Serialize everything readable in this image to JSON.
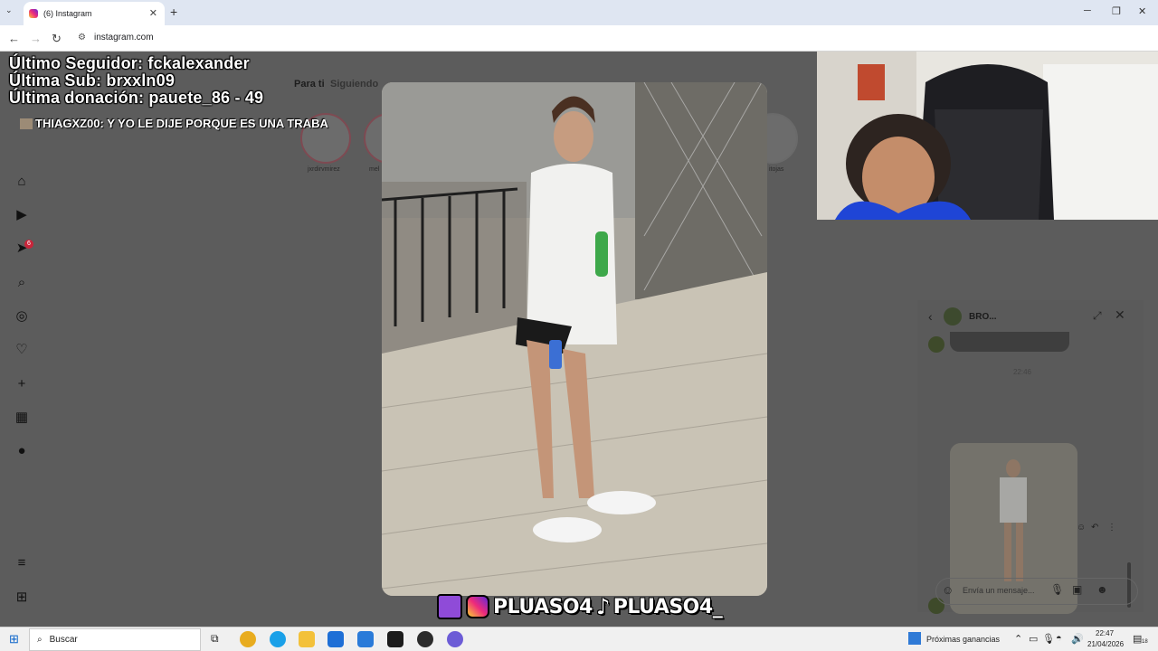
{
  "browser": {
    "tab_title": "(6) Instagram",
    "url": "instagram.com"
  },
  "stream_overlay": {
    "last_follower": "Último Seguidor: fckalexander",
    "last_sub": "Última Sub: brxxln09",
    "last_donation": "Última donación: pauete_86 - 49",
    "chat_message": "THIAGXZ00: Y YO LE DIJE PORQUE ES UNA TRABA",
    "handle_1": "PLUASO4",
    "handle_2": "PLUASO4_"
  },
  "instagram": {
    "sidebar_badge": "6",
    "feed_tabs": [
      "Para ti",
      "Siguiendo"
    ],
    "stories": [
      "jxrdirvmirez",
      "mel",
      "itojas"
    ],
    "dm": {
      "name": "BRO...",
      "timestamp": "22:46",
      "input_placeholder": "Envía un mensaje..."
    }
  },
  "taskbar": {
    "search_label": "Buscar",
    "news_label": "Próximas ganancias",
    "time": "22:47",
    "date": "21/04/2026",
    "notifications": "18"
  },
  "colors": {
    "overlay_bg": "#5c5c5c",
    "instagram_gradient": "#ee2a7b",
    "twitch": "#8f4bd8",
    "badge": "#c9243a"
  }
}
